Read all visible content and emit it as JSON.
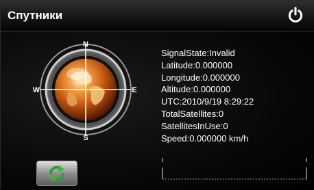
{
  "header": {
    "title": "Спутники",
    "power_icon": "power-icon"
  },
  "compass": {
    "north": "N",
    "south": "S",
    "west": "W",
    "east": "E",
    "globe_icon": "globe-icon"
  },
  "info": {
    "signal_state": "SignalState:Invalid",
    "latitude": "Latitude:0.000000",
    "longitude": "Longitude:0.000000",
    "altitude": "Altitude:0.000000",
    "utc": "UTC:2010/9/19 8:29:22",
    "total_satellites": "TotalSatellites:0",
    "satellites_in_use": "SatellitesInUse:0",
    "speed": "Speed:0.000000 km/h"
  },
  "controls": {
    "refresh_icon": "refresh-icon"
  },
  "colors": {
    "background": "#000000",
    "text": "#ffffff",
    "accent_green": "#3ab73a",
    "globe_orange": "#e07a24"
  }
}
